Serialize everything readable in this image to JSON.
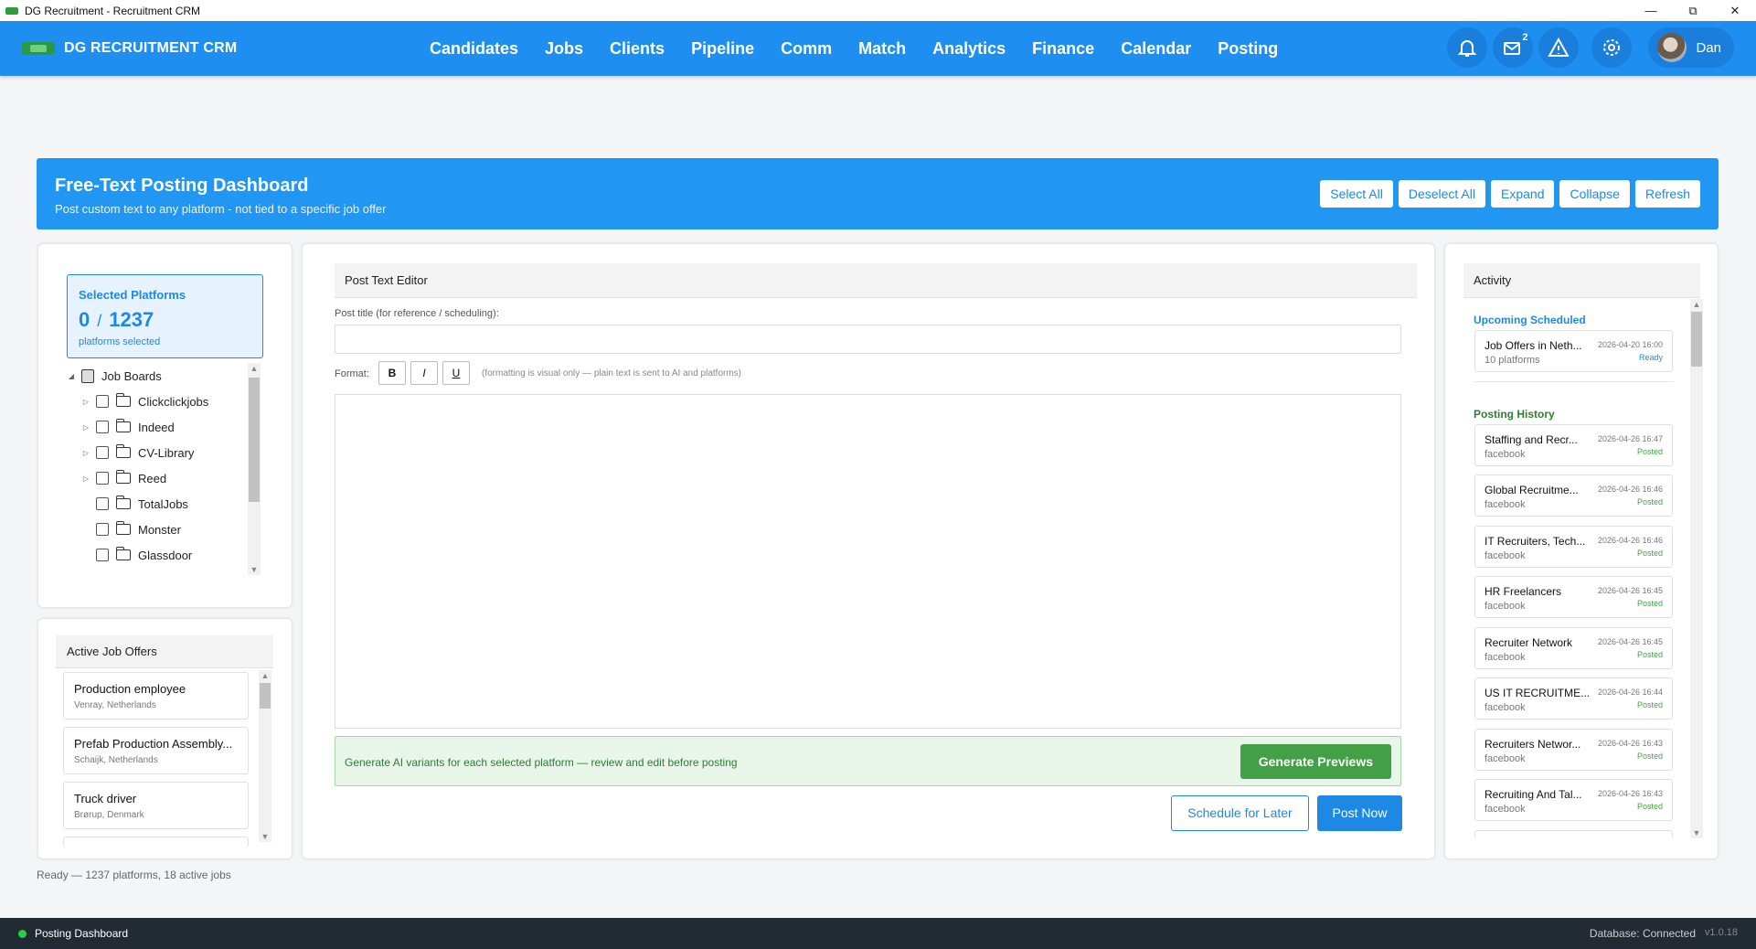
{
  "window": {
    "title": "DG Recruitment - Recruitment CRM",
    "minimize": "—",
    "maximize": "⧉",
    "close": "✕"
  },
  "nav": {
    "brand": "DG RECRUITMENT CRM",
    "links": [
      "Candidates",
      "Jobs",
      "Clients",
      "Pipeline",
      "Comm",
      "Match",
      "Analytics",
      "Finance",
      "Calendar",
      "Posting"
    ],
    "mail_badge": "2",
    "user": "Dan"
  },
  "banner": {
    "title": "Free-Text Posting Dashboard",
    "subtitle": "Post custom text to any platform - not tied to a specific job offer",
    "actions": [
      "Select All",
      "Deselect All",
      "Expand",
      "Collapse",
      "Refresh"
    ]
  },
  "platforms": {
    "selected_title": "Selected Platforms",
    "selected": "0",
    "total": "1237",
    "selected_sub": "platforms selected",
    "root": "Job Boards",
    "items": [
      {
        "label": "Clickclickjobs",
        "expandable": true
      },
      {
        "label": "Indeed",
        "expandable": true
      },
      {
        "label": "CV-Library",
        "expandable": true
      },
      {
        "label": "Reed",
        "expandable": true
      },
      {
        "label": "TotalJobs",
        "expandable": false
      },
      {
        "label": "Monster",
        "expandable": false
      },
      {
        "label": "Glassdoor",
        "expandable": false
      }
    ]
  },
  "jobs": {
    "title": "Active Job Offers",
    "items": [
      {
        "title": "Production employee",
        "location": "Venray, Netherlands"
      },
      {
        "title": "Prefab Production Assembly...",
        "location": "Schaijk, Netherlands"
      },
      {
        "title": "Truck driver",
        "location": "Brørup, Denmark"
      }
    ]
  },
  "status": "Ready — 1237 platforms, 18 active jobs",
  "editor": {
    "title": "Post Text Editor",
    "post_title_label": "Post title (for reference / scheduling):",
    "post_title_value": "",
    "format_label": "Format:",
    "bold": "B",
    "italic": "I",
    "underline": "U",
    "format_hint": "(formatting is visual only — plain text is sent to AI and platforms)",
    "body": "",
    "generate_hint": "Generate AI variants for each selected platform — review and edit before posting",
    "generate_button": "Generate Previews",
    "schedule_button": "Schedule for Later",
    "post_button": "Post Now"
  },
  "activity": {
    "title": "Activity",
    "upcoming_title": "Upcoming Scheduled",
    "upcoming": [
      {
        "name": "Job Offers in Neth...",
        "sub": "10 platforms",
        "date": "2026-04-20 16:00",
        "status": "Ready"
      }
    ],
    "history_title": "Posting History",
    "history": [
      {
        "name": "Staffing and Recr...",
        "sub": "facebook",
        "date": "2026-04-26 16:47",
        "status": "Posted"
      },
      {
        "name": "Global Recruitme...",
        "sub": "facebook",
        "date": "2026-04-26 16:46",
        "status": "Posted"
      },
      {
        "name": "IT Recruiters, Tech...",
        "sub": "facebook",
        "date": "2026-04-26 16:46",
        "status": "Posted"
      },
      {
        "name": "HR Freelancers",
        "sub": "facebook",
        "date": "2026-04-26 16:45",
        "status": "Posted"
      },
      {
        "name": "Recruiter Network",
        "sub": "facebook",
        "date": "2026-04-26 16:45",
        "status": "Posted"
      },
      {
        "name": "US IT RECRUITME...",
        "sub": "facebook",
        "date": "2026-04-26 16:44",
        "status": "Posted"
      },
      {
        "name": "Recruiters Networ...",
        "sub": "facebook",
        "date": "2026-04-26 16:43",
        "status": "Posted"
      },
      {
        "name": "Recruiting And Tal...",
        "sub": "facebook",
        "date": "2026-04-26 16:43",
        "status": "Posted"
      }
    ]
  },
  "footer": {
    "label": "Posting Dashboard",
    "db": "Database: Connected",
    "version": "v1.0.18"
  },
  "colors": {
    "primary": "#1e88e5",
    "nav": "#1e8ff0",
    "success": "#43a047",
    "footer": "#222a33"
  }
}
